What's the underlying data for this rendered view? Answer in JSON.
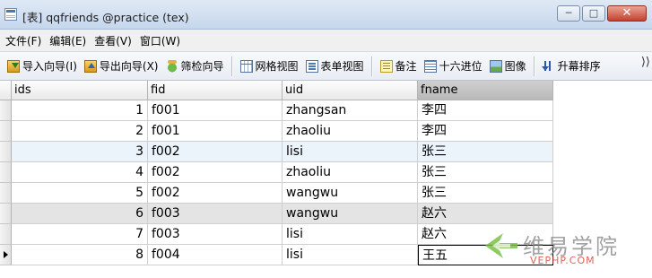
{
  "window": {
    "title": "[表] qqfriends @practice (tex)",
    "controls": [
      "─",
      "□",
      "✕"
    ]
  },
  "menu": [
    {
      "label": "文件(F)"
    },
    {
      "label": "编辑(E)"
    },
    {
      "label": "查看(V)"
    },
    {
      "label": "窗口(W)"
    }
  ],
  "toolbar": {
    "import": "导入向导(I)",
    "export": "导出向导(X)",
    "filter": "筛检向导",
    "grid_view": "网格视图",
    "form_view": "表单视图",
    "memo": "备注",
    "hex": "十六进位",
    "image": "图像",
    "sort_asc": "升幕排序",
    "more": "⟩⟩"
  },
  "table": {
    "columns": [
      "ids",
      "fid",
      "uid",
      "fname"
    ],
    "rows": [
      {
        "ids": "1",
        "fid": "f001",
        "uid": "zhangsan",
        "fname": "李四"
      },
      {
        "ids": "2",
        "fid": "f001",
        "uid": "zhaoliu",
        "fname": "李四"
      },
      {
        "ids": "3",
        "fid": "f002",
        "uid": "lisi",
        "fname": "张三"
      },
      {
        "ids": "4",
        "fid": "f002",
        "uid": "zhaoliu",
        "fname": "张三"
      },
      {
        "ids": "5",
        "fid": "f002",
        "uid": "wangwu",
        "fname": "张三"
      },
      {
        "ids": "6",
        "fid": "f003",
        "uid": "wangwu",
        "fname": "赵六"
      },
      {
        "ids": "7",
        "fid": "f003",
        "uid": "lisi",
        "fname": "赵六"
      },
      {
        "ids": "8",
        "fid": "f004",
        "uid": "lisi",
        "fname": "王五"
      }
    ],
    "selected_column": "fname",
    "current_row": 8
  },
  "watermark": {
    "cn": "维易学院",
    "en": "VEPHP.COM"
  },
  "colors": {
    "accent": "#4a78b4",
    "alt_row": "#ebf3fb",
    "selected_row": "#e4e4e4",
    "watermark_green": "#7ac143",
    "watermark_red": "#d64a3c"
  }
}
